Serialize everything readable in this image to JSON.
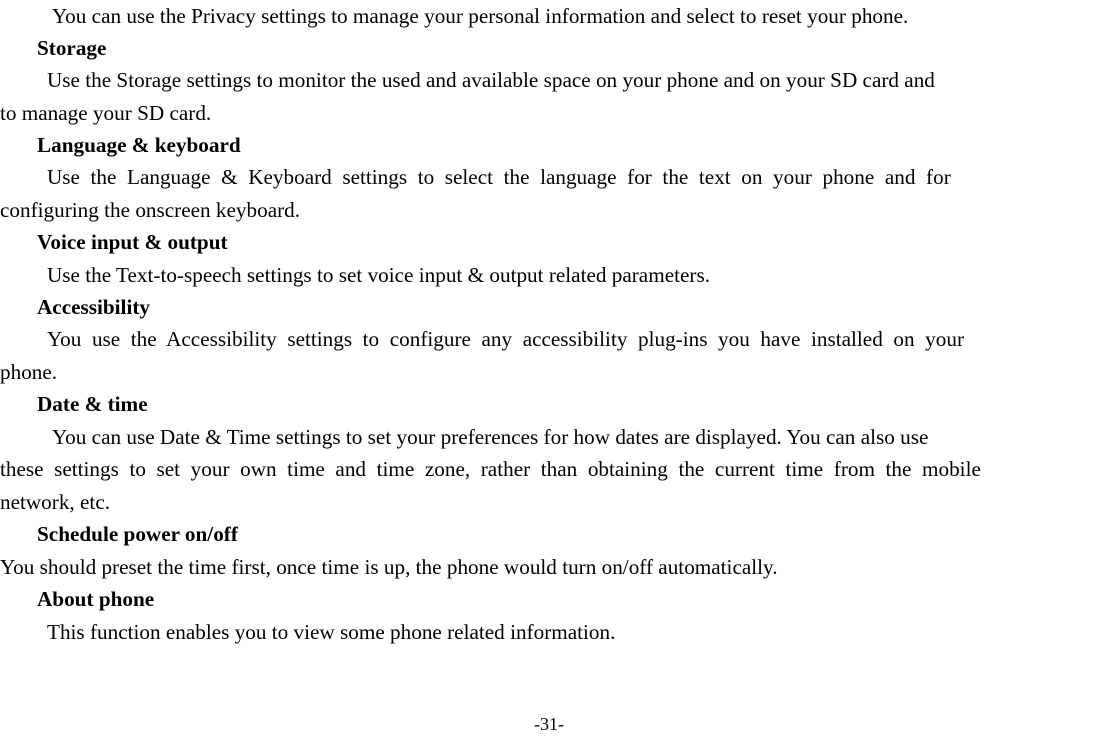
{
  "document": {
    "type": "phone-user-manual-page",
    "page_label": "-31-",
    "text_color": "#000000",
    "background_color": "#ffffff"
  },
  "body": {
    "lines": [
      {
        "id": "privacy_body_1",
        "role": "paragraph-first-line",
        "text": "You can use the Privacy settings to manage your personal information and select to reset your phone."
      }
    ]
  },
  "sections": [
    {
      "heading": "Storage",
      "paragraph": "Use the Storage settings to monitor the used and available space on your phone and on your SD card and to manage your SD card.",
      "lines": [
        "Use the Storage settings to monitor the used and available space on your phone and on your SD card and",
        "to manage your SD card."
      ]
    },
    {
      "heading": "Language & keyboard",
      "paragraph": "Use the Language & Keyboard settings to select the language for the text on your phone and for configuring the onscreen keyboard.",
      "lines": [
        "Use  the  Language  &  Keyboard  settings  to  select  the  language  for  the  text  on  your  phone  and  for",
        "configuring the onscreen keyboard."
      ]
    },
    {
      "heading": "Voice input & output",
      "paragraph": "Use the Text-to-speech settings to set voice input & output related parameters.",
      "lines": [
        "Use the Text-to-speech settings to set voice input & output related parameters."
      ]
    },
    {
      "heading": "Accessibility",
      "paragraph": "You use the Accessibility settings to configure any accessibility plug-ins you have installed on your phone.",
      "lines": [
        "You  use  the  Accessibility  settings  to  configure  any  accessibility  plug-ins  you  have  installed  on  your",
        "phone."
      ]
    },
    {
      "heading": "Date & time",
      "paragraph": "You can use Date & Time settings to set your preferences for how dates are displayed. You can also use these settings to set your own time and time zone, rather than obtaining the current time from the mobile network, etc.",
      "lines": [
        "You can use Date & Time settings to set your preferences for how dates are displayed. You can also use",
        "these  settings  to  set  your  own  time  and  time  zone,  rather  than  obtaining  the  current  time  from  the  mobile",
        "network, etc."
      ]
    },
    {
      "heading": "Schedule power on/off",
      "paragraph": "You should preset the time first, once time is up, the phone would turn on/off automatically.",
      "lines": [
        "You should preset the time first, once time is up, the phone would turn on/off automatically."
      ]
    },
    {
      "heading": "About phone",
      "paragraph": "This function enables you to view some phone related information.",
      "lines": [
        "This function enables you to view some phone related information."
      ]
    }
  ],
  "footer": {
    "page_number": "-31-"
  }
}
